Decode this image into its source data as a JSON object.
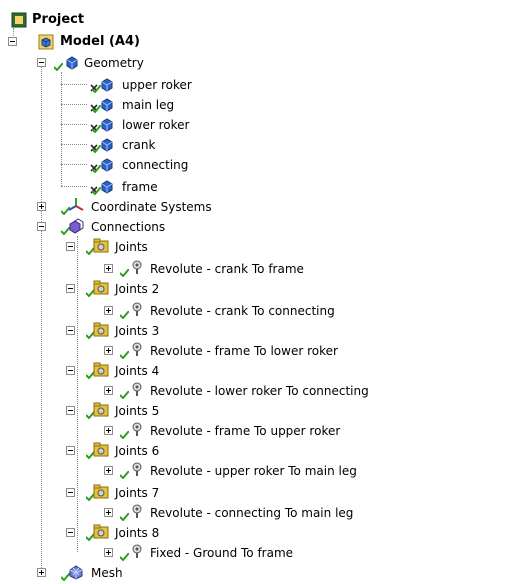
{
  "tree": {
    "project": "Project",
    "model": "Model (A4)",
    "geometry": {
      "label": "Geometry",
      "parts": [
        "upper roker",
        "main leg",
        "lower roker",
        "crank",
        "connecting",
        "frame"
      ]
    },
    "coordinate_systems": "Coordinate Systems",
    "connections": {
      "label": "Connections",
      "groups": [
        {
          "label": "Joints",
          "child": "Revolute - crank To frame"
        },
        {
          "label": "Joints 2",
          "child": "Revolute - crank To connecting"
        },
        {
          "label": "Joints 3",
          "child": "Revolute - frame To lower roker"
        },
        {
          "label": "Joints 4",
          "child": "Revolute - lower roker To connecting"
        },
        {
          "label": "Joints 5",
          "child": "Revolute - frame To upper roker"
        },
        {
          "label": "Joints 6",
          "child": "Revolute - upper roker To main leg"
        },
        {
          "label": "Joints 7",
          "child": "Revolute - connecting To main leg"
        },
        {
          "label": "Joints 8",
          "child": "Fixed - Ground To frame"
        }
      ]
    },
    "mesh": "Mesh"
  },
  "colors": {
    "check_green": "#2f9e1e",
    "x_mark": "#2a2a2a",
    "tree_line": "#8a8a8a",
    "part_blue": "#2e62c9",
    "folder_yellow": "#e6c23a"
  }
}
